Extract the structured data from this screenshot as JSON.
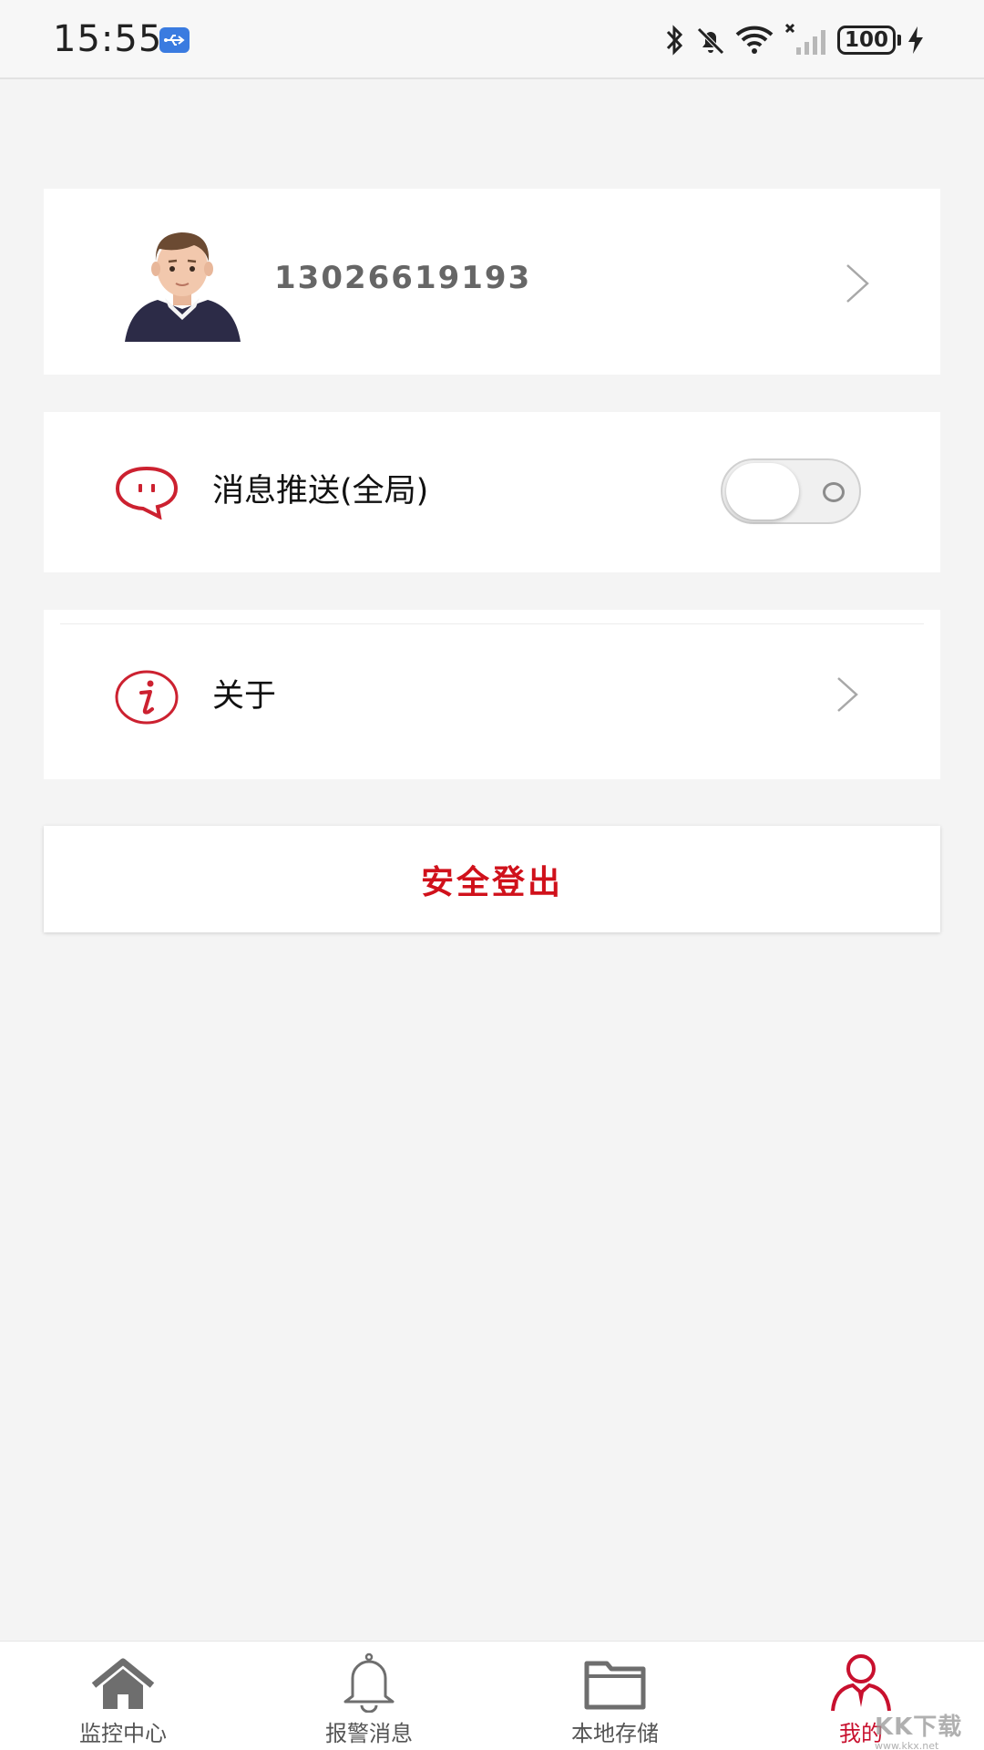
{
  "status_bar": {
    "time": "15:55",
    "battery": "100",
    "icons": [
      "usb-icon",
      "bluetooth-icon",
      "bell-muted-icon",
      "wifi-icon",
      "signal-icon",
      "battery-icon",
      "charging-icon"
    ]
  },
  "profile": {
    "phone": "13026619193"
  },
  "settings": {
    "push_label": "消息推送(全局)",
    "push_enabled": false,
    "about_label": "关于"
  },
  "logout": {
    "label": "安全登出"
  },
  "bottom_nav": {
    "items": [
      {
        "label": "监控中心",
        "icon": "home-icon",
        "active": false
      },
      {
        "label": "报警消息",
        "icon": "bell-icon",
        "active": false
      },
      {
        "label": "本地存储",
        "icon": "folder-icon",
        "active": false
      },
      {
        "label": "我的",
        "icon": "user-icon",
        "active": true
      }
    ]
  },
  "watermark": {
    "text": "KK下载",
    "url": "www.kkx.net"
  },
  "colors": {
    "accent": "#c8102e",
    "background": "#f4f4f4",
    "card": "#ffffff",
    "muted_text": "#666666"
  }
}
